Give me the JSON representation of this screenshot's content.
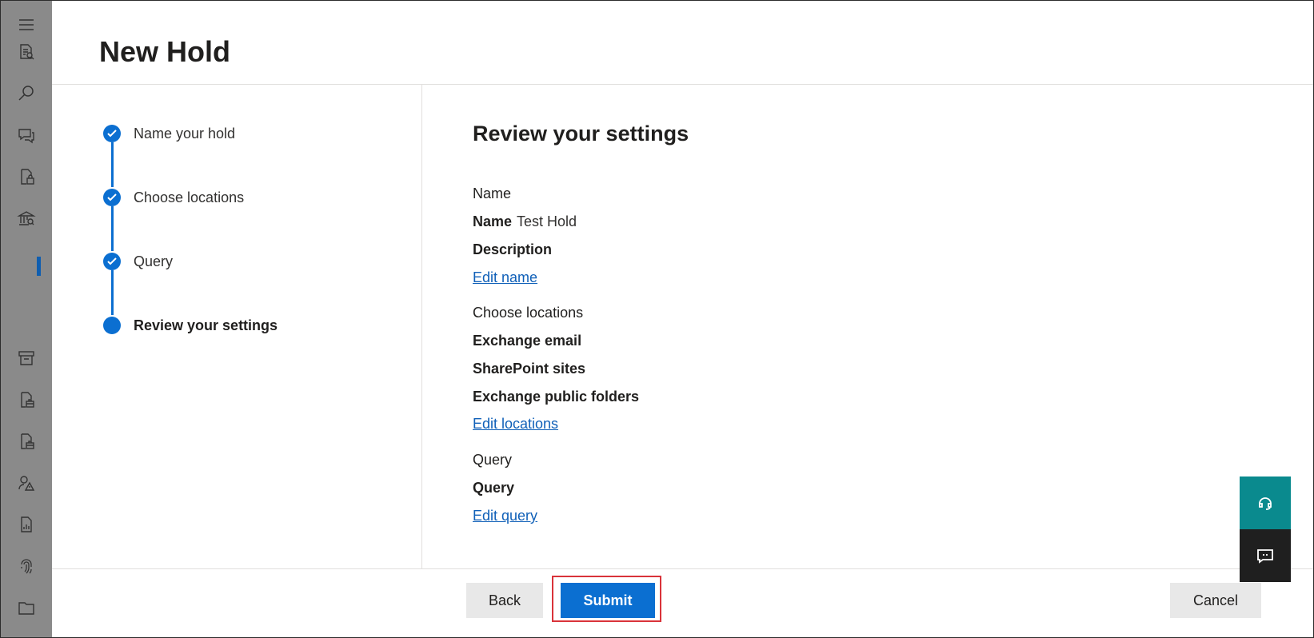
{
  "page": {
    "title": "New Hold"
  },
  "rail": {
    "icons": [
      "hamburger-menu-icon",
      "document-search-icon",
      "search-icon",
      "chat-icon",
      "document-lock-icon",
      "bank-search-icon",
      "archive-icon",
      "document-briefcase-icon",
      "document-briefcase-icon",
      "person-warning-icon",
      "document-chart-icon",
      "fingerprint-icon",
      "folder-icon"
    ]
  },
  "steps": [
    {
      "label": "Name your hold",
      "state": "completed"
    },
    {
      "label": "Choose locations",
      "state": "completed"
    },
    {
      "label": "Query",
      "state": "completed"
    },
    {
      "label": "Review your settings",
      "state": "current"
    }
  ],
  "review": {
    "heading": "Review your settings",
    "name_section": {
      "title": "Name",
      "name_label": "Name",
      "name_value": "Test Hold",
      "description_label": "Description",
      "edit_link": "Edit name"
    },
    "locations_section": {
      "title": "Choose locations",
      "items": [
        "Exchange email",
        "SharePoint sites",
        "Exchange public folders"
      ],
      "edit_link": "Edit locations"
    },
    "query_section": {
      "title": "Query",
      "query_label": "Query",
      "edit_link": "Edit query"
    }
  },
  "footer": {
    "back_label": "Back",
    "submit_label": "Submit",
    "cancel_label": "Cancel"
  },
  "colors": {
    "accent": "#0b6fd1",
    "rail": "#8a8a8a",
    "help_button": "#0a8a8e",
    "feedback_button": "#1f1f1f",
    "highlight_outline": "#d9333a"
  }
}
